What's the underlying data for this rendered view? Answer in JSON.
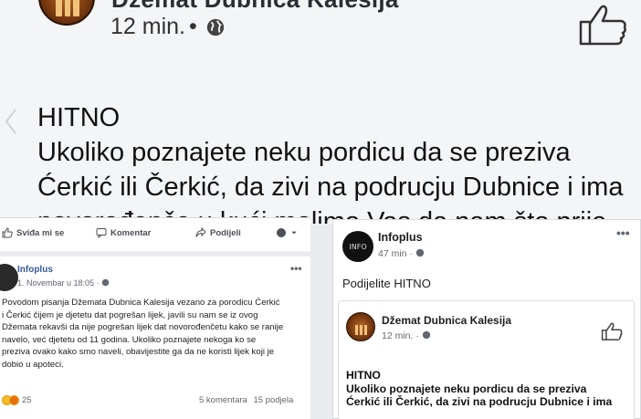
{
  "big_post": {
    "page_name": "Džemat Dubnica Kalesija",
    "time": "12 min.",
    "separator": "•",
    "lines": [
      "HITNO",
      "Ukoliko poznajete neku pordicu da se preziva",
      "Ćerkić ili Čerkić, da zivi na podrucju Dubnice i ima",
      "novorođenče u kući molimo Vas da nam što prije"
    ]
  },
  "left_post": {
    "actions": {
      "like": "Sviđa mi se",
      "comment": "Komentar",
      "share": "Podijeli"
    },
    "author": "Infoplus",
    "date": "1. Novembar u 18:05 ·",
    "more": "•••",
    "body_lines": [
      "Povodom pisanja Džemata Dubnica Kalesija vezano za porodicu Ćerkić",
      "i Čerkić čijem je djetetu dat pogrešan lijek, javili su nam se iz ovog",
      "Džemata rekavši da nije pogrešan lijek dat novorođenčetu kako se ranije",
      "navelo, već djetetu od 11 godina. Ukoliko poznajete nekoga ko se",
      "preziva ovako kako smo naveli, obavijestite ga da ne koristi lijek koji je",
      "dobio u apoteci."
    ],
    "reaction_count": "25",
    "comments": "5 komentara",
    "shares": "15 podjela"
  },
  "right_post": {
    "author": "Infoplus",
    "avatar_text": "INFO",
    "time": "47 min ·",
    "more": "•••",
    "text": "Podijelite HITNO",
    "shared": {
      "page_name": "Džemat Dubnica Kalesija",
      "time": "12 min. ·",
      "lines": [
        "HITNO",
        "Ukoliko poznajete neku pordicu da se preziva",
        "Ćerkić ili Čerkić, da zivi na podrucju Dubnice i ima"
      ]
    }
  }
}
